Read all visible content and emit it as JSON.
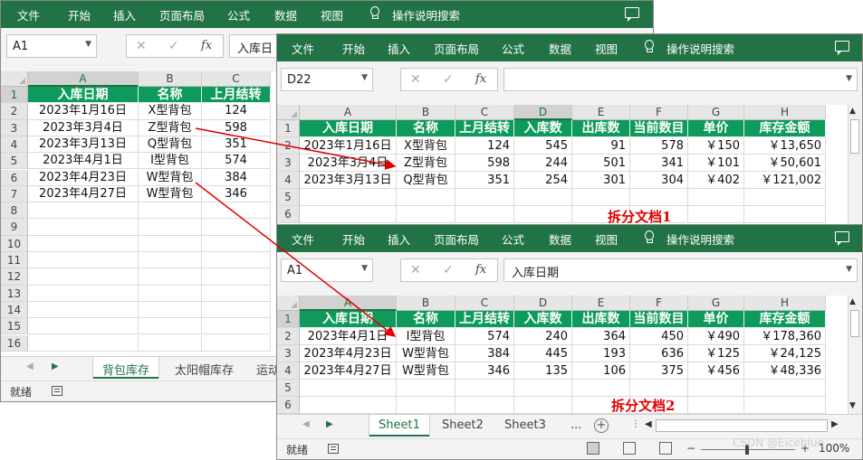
{
  "menu": [
    "文件",
    "开始",
    "插入",
    "页面布局",
    "公式",
    "数据",
    "视图"
  ],
  "tell_me": "操作说明搜索",
  "columns": [
    "A",
    "B",
    "C",
    "D",
    "E",
    "F",
    "G",
    "H"
  ],
  "headers": [
    "入库日期",
    "名称",
    "上月结转",
    "入库数",
    "出库数",
    "当前数目",
    "单价",
    "库存金额"
  ],
  "main": {
    "namebox": "A1",
    "formula": "入库日",
    "rows": [
      [
        "2023年1月16日",
        "X型背包",
        "124"
      ],
      [
        "2023年3月4日",
        "Z型背包",
        "598"
      ],
      [
        "2023年3月13日",
        "Q型背包",
        "351"
      ],
      [
        "2023年4月1日",
        "I型背包",
        "574"
      ],
      [
        "2023年4月23日",
        "W型背包",
        "384"
      ],
      [
        "2023年4月27日",
        "W型背包",
        "346"
      ]
    ],
    "row_numbers": [
      "1",
      "2",
      "3",
      "4",
      "5",
      "6",
      "7",
      "8",
      "9",
      "10",
      "11",
      "12",
      "13",
      "14",
      "15",
      "16"
    ],
    "tabs": [
      "背包库存",
      "太阳帽库存",
      "运动"
    ],
    "status": "就绪"
  },
  "doc1": {
    "namebox": "D22",
    "formula": "",
    "rows": [
      [
        "2023年1月16日",
        "X型背包",
        "124",
        "545",
        "91",
        "578",
        "￥150",
        "￥13,650"
      ],
      [
        "2023年3月4日",
        "Z型背包",
        "598",
        "244",
        "501",
        "341",
        "￥101",
        "￥50,601"
      ],
      [
        "2023年3月13日",
        "Q型背包",
        "351",
        "254",
        "301",
        "304",
        "￥402",
        "￥121,002"
      ]
    ],
    "row_numbers": [
      "1",
      "2",
      "3",
      "4",
      "5",
      "6"
    ],
    "label": "拆分文档1"
  },
  "doc2": {
    "namebox": "A1",
    "formula": "入库日期",
    "rows": [
      [
        "2023年4月1日",
        "I型背包",
        "574",
        "240",
        "364",
        "450",
        "￥490",
        "￥178,360"
      ],
      [
        "2023年4月23日",
        "W型背包",
        "384",
        "445",
        "193",
        "636",
        "￥125",
        "￥24,125"
      ],
      [
        "2023年4月27日",
        "W型背包",
        "346",
        "135",
        "106",
        "375",
        "￥456",
        "￥48,336"
      ]
    ],
    "row_numbers": [
      "1",
      "2",
      "3",
      "4",
      "5",
      "6"
    ],
    "label": "拆分文档2",
    "tabs": [
      "Sheet1",
      "Sheet2",
      "Sheet3",
      "..."
    ],
    "status": "就绪",
    "zoom": "100%"
  },
  "watermark": "CSDN @Eiceblue",
  "colors": {
    "ribbon": "#217346",
    "header_fill": "#0d9a5a",
    "arrow": "#e00000",
    "label": "#e00000"
  }
}
